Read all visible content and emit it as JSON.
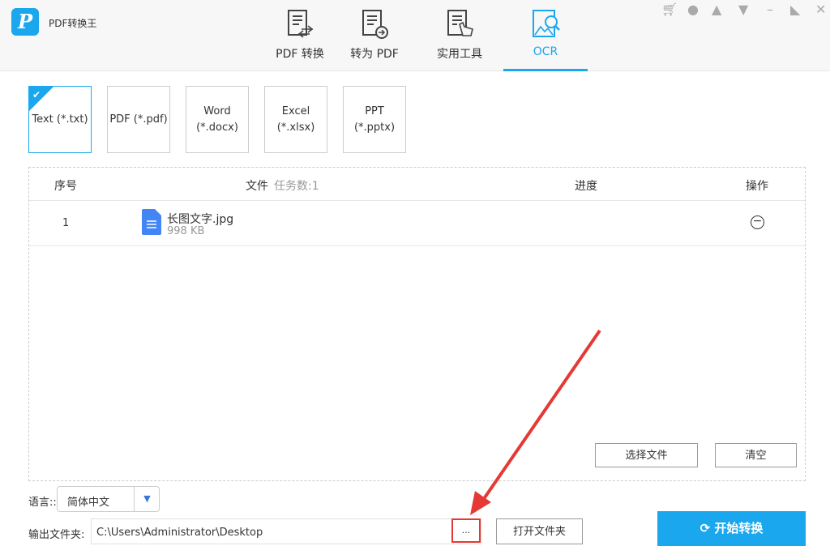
{
  "app": {
    "title": "PDF转换王",
    "logo": "P"
  },
  "tabs": [
    {
      "label": "PDF 转换"
    },
    {
      "label": "转为 PDF"
    },
    {
      "label": "实用工具"
    },
    {
      "label": "OCR"
    }
  ],
  "formats": [
    {
      "label": "Text (*.txt)"
    },
    {
      "label": "PDF (*.pdf)"
    },
    {
      "label": "Word\n(*.docx)"
    },
    {
      "label": "Excel (*.xlsx)"
    },
    {
      "label": "PPT (*.pptx)"
    }
  ],
  "table": {
    "col_index": "序号",
    "col_file": "文件",
    "task_count": "任务数:1",
    "col_progress": "进度",
    "col_action": "操作",
    "rows": [
      {
        "index": "1",
        "name": "长图文字.jpg",
        "size": "998 KB"
      }
    ]
  },
  "buttons": {
    "select_files": "选择文件",
    "clear": "清空",
    "browse": "...",
    "open_folder": "打开文件夹",
    "start": "开始转换"
  },
  "language": {
    "label": "语言::",
    "value": "简体中文"
  },
  "output": {
    "label": "输出文件夹:",
    "path": "C:\\Users\\Administrator\\Desktop"
  }
}
